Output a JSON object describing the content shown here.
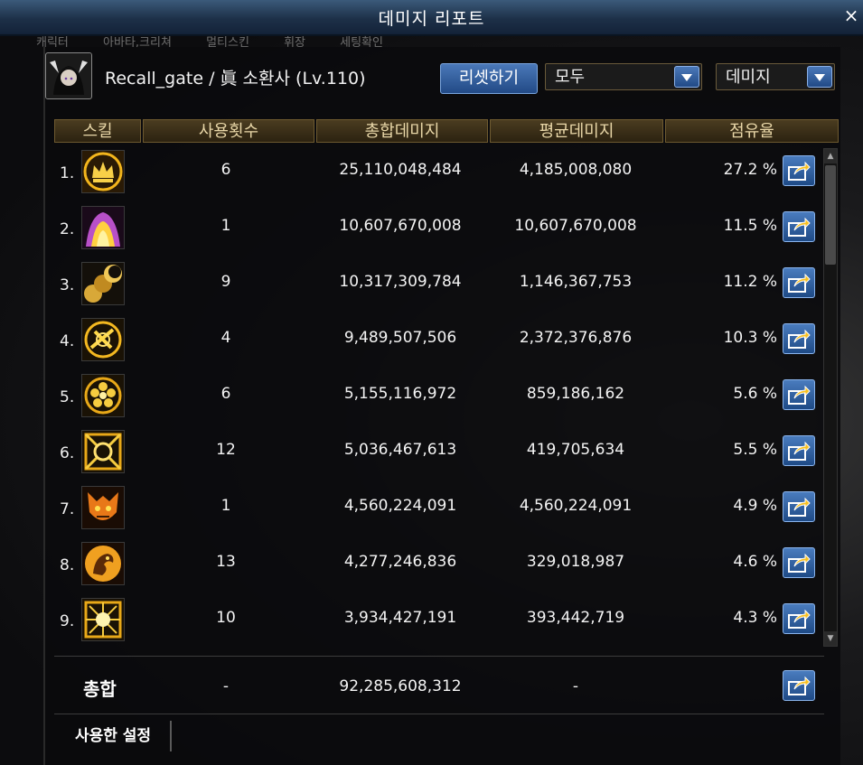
{
  "window": {
    "title": "데미지 리포트",
    "close_label": "×"
  },
  "background_tabs": [
    "캐릭터",
    "아바타,크리쳐",
    "멀티스킨",
    "휘장",
    "세팅확인"
  ],
  "header": {
    "player": "Recall_gate / 眞 소환사 (Lv.110)",
    "reset_label": "리셋하기",
    "filter_value": "모두",
    "sort_value": "데미지"
  },
  "columns": {
    "skill": "스킬",
    "uses": "사용횟수",
    "total": "총합데미지",
    "avg": "평균데미지",
    "share": "점유율"
  },
  "rows": [
    {
      "rank": "1.",
      "uses": "6",
      "total": "25,110,048,484",
      "avg": "4,185,008,080",
      "share": "27.2 %",
      "icon": "crown-icon"
    },
    {
      "rank": "2.",
      "uses": "1",
      "total": "10,607,670,008",
      "avg": "10,607,670,008",
      "share": "11.5 %",
      "icon": "flame-maw-icon"
    },
    {
      "rank": "3.",
      "uses": "9",
      "total": "10,317,309,784",
      "avg": "1,146,367,753",
      "share": "11.2 %",
      "icon": "eclipse-orbs-icon"
    },
    {
      "rank": "4.",
      "uses": "4",
      "total": "9,489,507,506",
      "avg": "2,372,376,876",
      "share": "10.3 %",
      "icon": "rune-circle-icon"
    },
    {
      "rank": "5.",
      "uses": "6",
      "total": "5,155,116,972",
      "avg": "859,186,162",
      "share": "5.6 %",
      "icon": "flower-seal-icon"
    },
    {
      "rank": "6.",
      "uses": "12",
      "total": "5,036,467,613",
      "avg": "419,705,634",
      "share": "5.5 %",
      "icon": "cross-sigil-icon"
    },
    {
      "rank": "7.",
      "uses": "1",
      "total": "4,560,224,091",
      "avg": "4,560,224,091",
      "share": "4.9 %",
      "icon": "demon-mask-icon"
    },
    {
      "rank": "8.",
      "uses": "13",
      "total": "4,277,246,836",
      "avg": "329,018,987",
      "share": "4.6 %",
      "icon": "dragon-icon"
    },
    {
      "rank": "9.",
      "uses": "10",
      "total": "3,934,427,191",
      "avg": "393,442,719",
      "share": "4.3 %",
      "icon": "radiant-burst-icon"
    }
  ],
  "summary": {
    "label": "총합",
    "uses": "-",
    "total": "92,285,608,312",
    "avg": "-"
  },
  "footer": {
    "used_settings_label": "사용한 설정"
  },
  "colors": {
    "accent": "#2a5a9a",
    "gold": "#e9d7a8",
    "title_bar": "#1d3048"
  }
}
